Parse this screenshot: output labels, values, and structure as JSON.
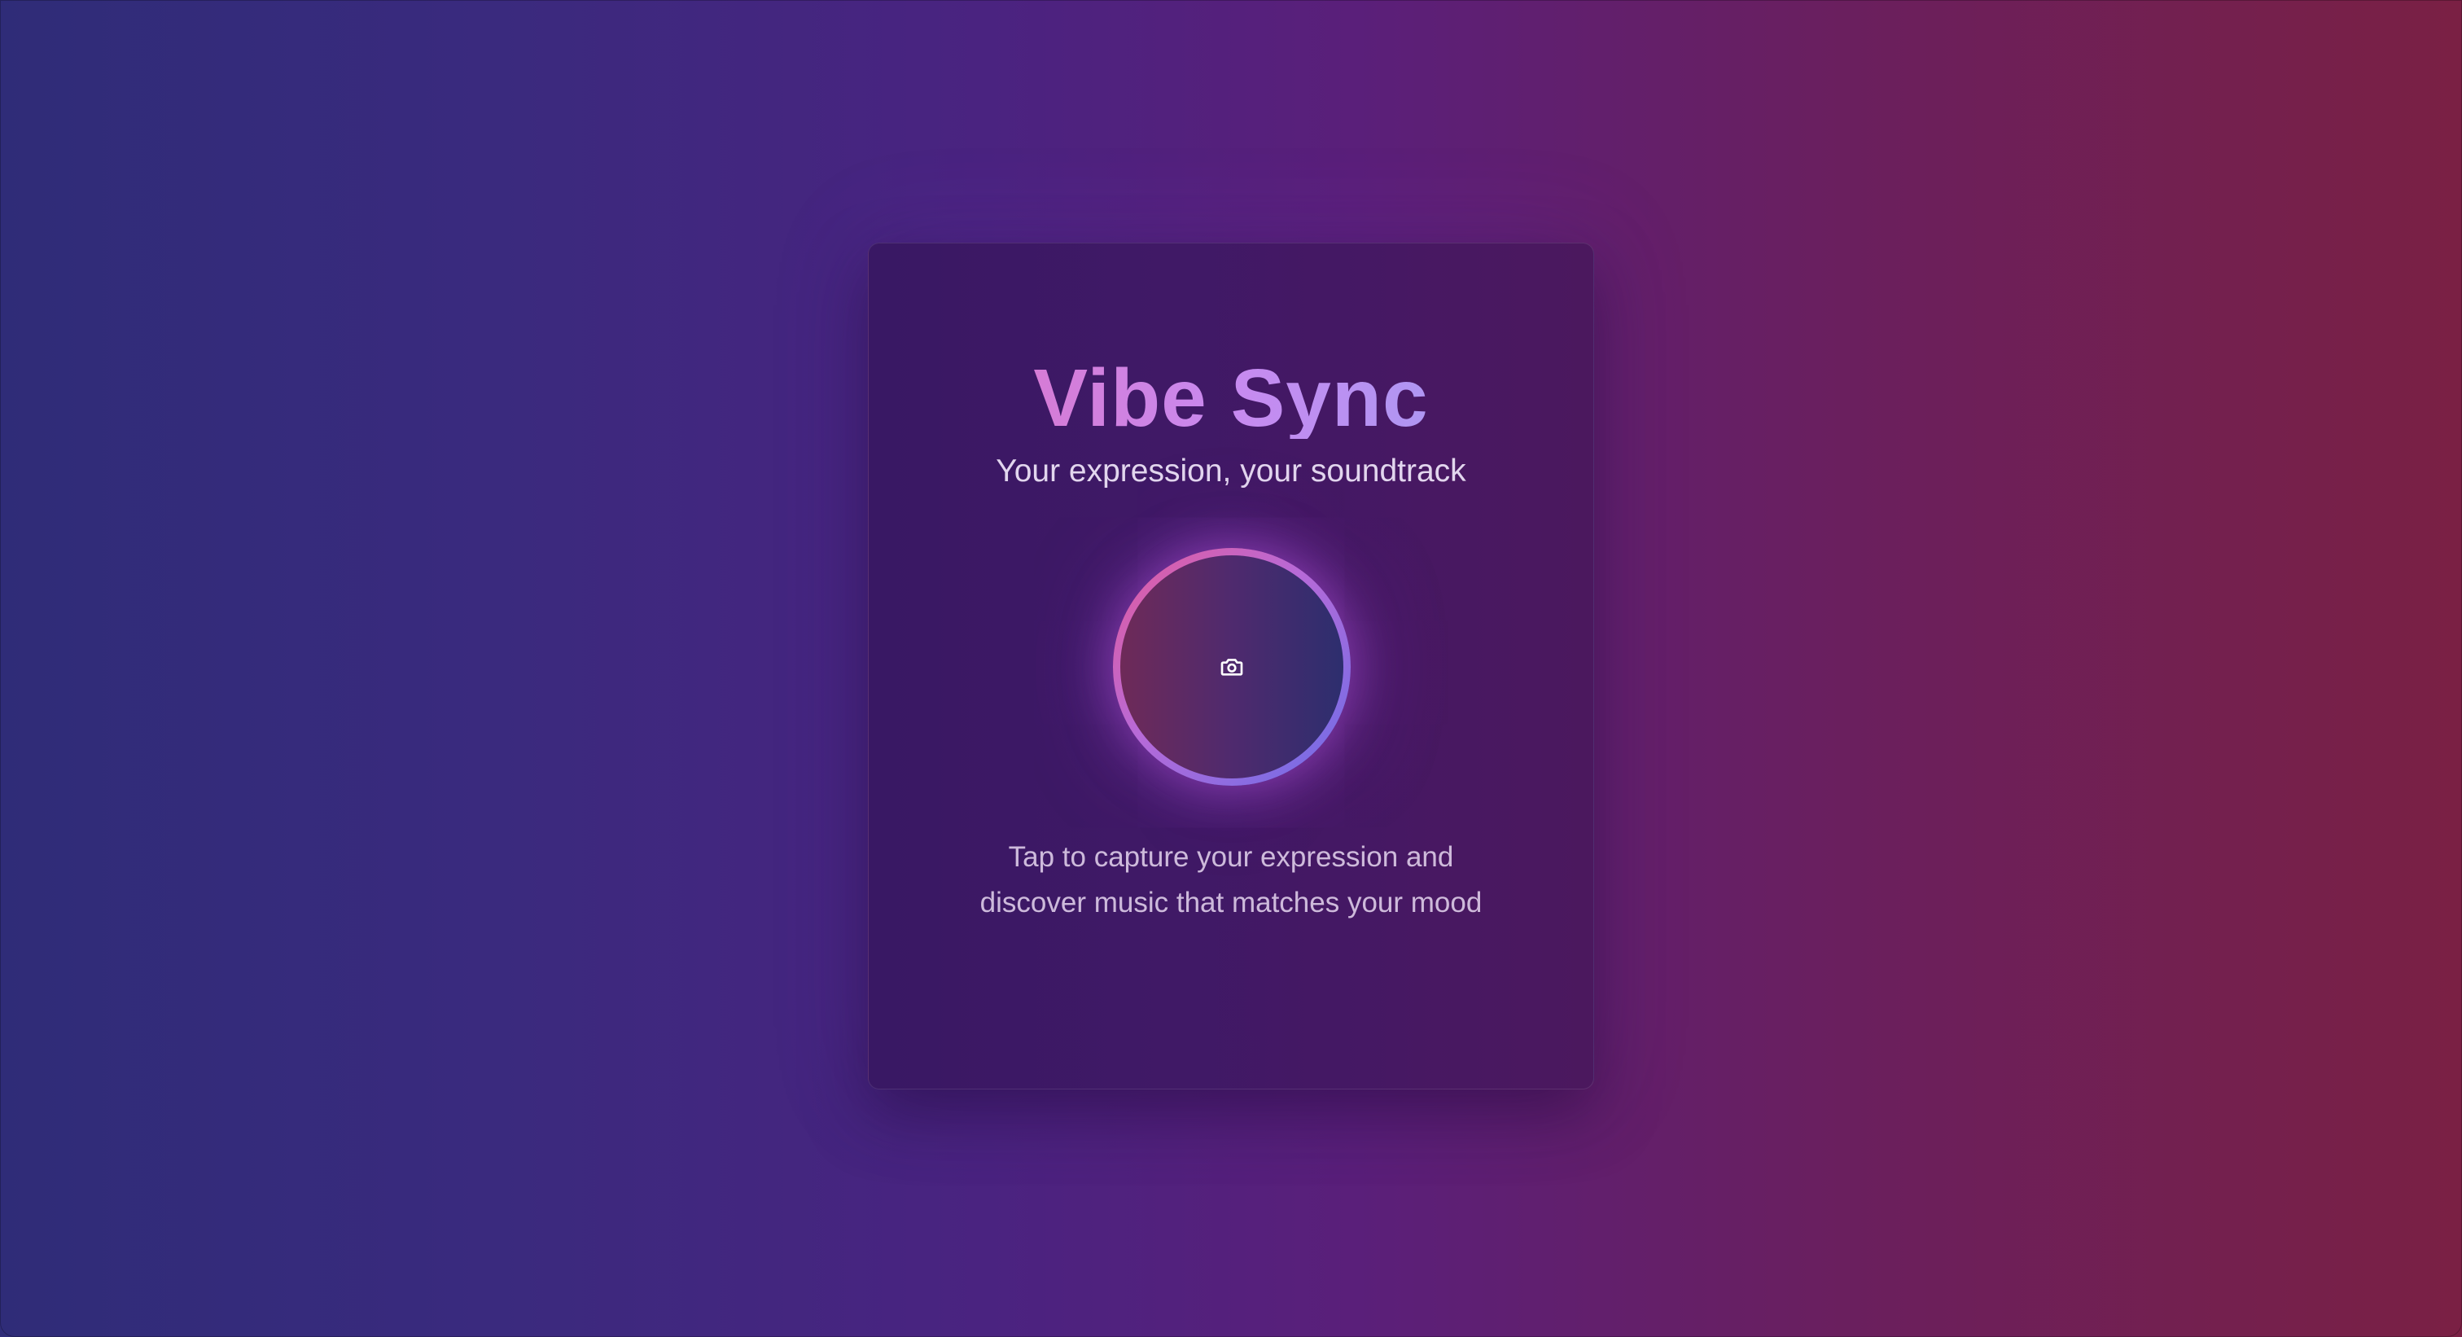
{
  "app": {
    "title": "Vibe Sync",
    "subtitle": "Your expression, your soundtrack"
  },
  "capture": {
    "icon": "camera-icon",
    "aria_label": "Capture expression"
  },
  "description": "Tap to capture your expression and discover music that matches your mood",
  "colors": {
    "background_start": "#2f2c78",
    "background_end": "#7a2044",
    "title_gradient": [
      "#e16fc0",
      "#c88af0",
      "#9aa0f5"
    ],
    "ring_gradient": [
      "#e35b9c",
      "#b76ad8",
      "#6a6de8"
    ]
  }
}
